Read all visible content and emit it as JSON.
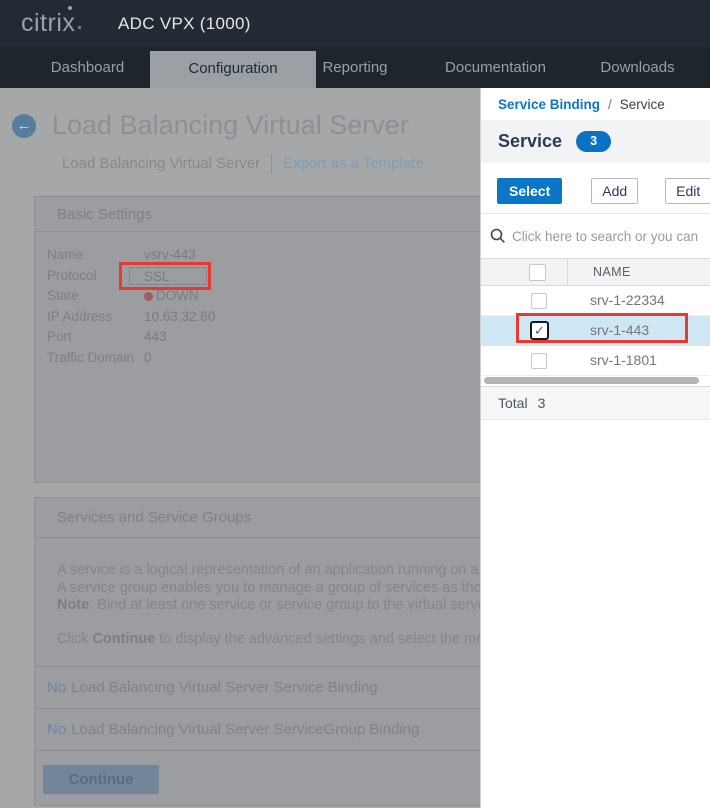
{
  "header": {
    "logo_text": "citri",
    "logo_x": "x",
    "product_name": "ADC VPX (1000)"
  },
  "nav": {
    "tabs": [
      {
        "label": "Dashboard"
      },
      {
        "label": "Configuration"
      },
      {
        "label": "Reporting"
      },
      {
        "label": "Documentation"
      },
      {
        "label": "Downloads"
      }
    ],
    "active_tab": "Configuration"
  },
  "main": {
    "back_icon": "←",
    "page_title": "Load Balancing Virtual Server",
    "view_tab_label": "Load Balancing Virtual Server",
    "export_link_label": "Export as a Template",
    "basic_settings": {
      "section_title": "Basic Settings",
      "fields": [
        {
          "label": "Name",
          "value": "vsrv-443"
        },
        {
          "label": "Protocol",
          "value": "SSL"
        },
        {
          "label": "State",
          "value": "DOWN"
        },
        {
          "label": "IP Address",
          "value": "10.63.32.60"
        },
        {
          "label": "Port",
          "value": "443"
        },
        {
          "label": "Traffic Domain",
          "value": "0"
        }
      ],
      "state_status": "down"
    },
    "services_section": {
      "section_title": "Services and Service Groups",
      "line1": "A service is a logical representation of an application running on a server.",
      "line2": "A service group enables you to manage a group of services as though it were a single service.",
      "note_label": "Note",
      "note_rest": ": Bind at least one service or service group to the virtual server.",
      "click_pre": "Click ",
      "continue_word": "Continue",
      "click_post": " to display the advanced settings and select the method, persistence, and protection settings."
    },
    "bindings": [
      {
        "no_label": "No",
        "text": "Load Balancing Virtual Server Service Binding"
      },
      {
        "no_label": "No",
        "text": "Load Balancing Virtual Server ServiceGroup Binding"
      }
    ],
    "continue_button_label": "Continue"
  },
  "panel": {
    "breadcrumb": {
      "parent": "Service Binding",
      "separator": "/",
      "current": "Service"
    },
    "title": "Service",
    "count_badge": "3",
    "buttons": {
      "select": "Select",
      "add": "Add",
      "edit": "Edit"
    },
    "search": {
      "placeholder": "Click here to search or you can enter"
    },
    "table": {
      "name_header": "NAME",
      "rows": [
        {
          "name": "srv-1-22334",
          "checked": false
        },
        {
          "name": "srv-1-443",
          "checked": true
        },
        {
          "name": "srv-1-1801",
          "checked": false
        }
      ],
      "checkmark": "✓",
      "total_label": "Total",
      "total_count": "3"
    }
  },
  "colors": {
    "accent_blue": "#0b76c6",
    "annotation_red": "#e6392f",
    "selected_row_bg": "#cfe6f4",
    "status_down_red": "#a25b59",
    "topbar_bg": "#232a33",
    "navbar_bg": "#1f252d"
  }
}
